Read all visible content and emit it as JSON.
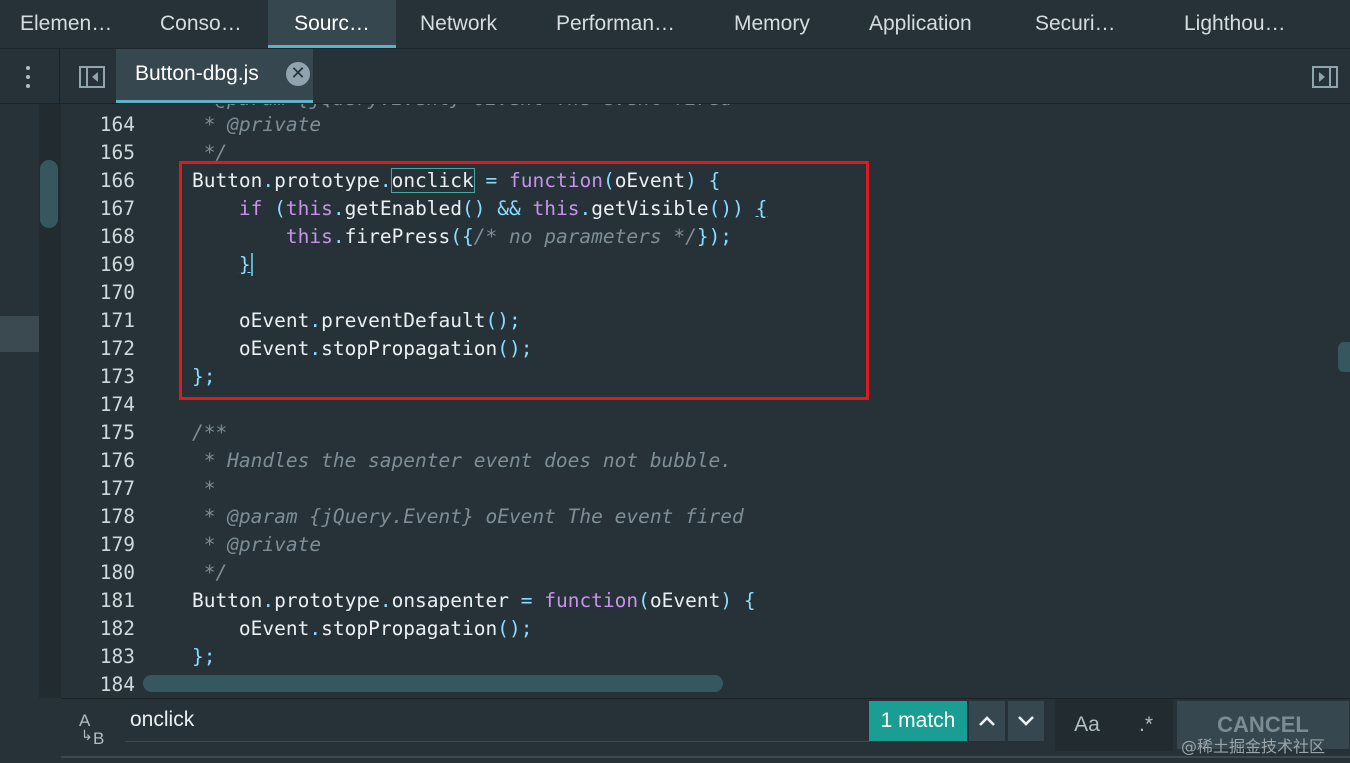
{
  "tabs": [
    {
      "label": "Elemen…"
    },
    {
      "label": "Conso…"
    },
    {
      "label": "Sourc…"
    },
    {
      "label": "Network"
    },
    {
      "label": "Performan…"
    },
    {
      "label": "Memory"
    },
    {
      "label": "Application"
    },
    {
      "label": "Securi…"
    },
    {
      "label": "Lighthou…"
    }
  ],
  "active_tab": "Sourc…",
  "file_tab": {
    "name": "Button-dbg.js",
    "close_glyph": "✕"
  },
  "line_numbers": [
    "164",
    "165",
    "166",
    "167",
    "168",
    "169",
    "170",
    "171",
    "172",
    "173",
    "174",
    "175",
    "176",
    "177",
    "178",
    "179",
    "180",
    "181",
    "182",
    "183",
    "184"
  ],
  "search": {
    "value": "onclick",
    "match_count": "1 match",
    "prev_glyph": "⌃",
    "next_glyph": "⌄",
    "case_label": "Aa",
    "regex_label": ".*",
    "cancel_label": "CANCEL",
    "ab_icon_top": "A",
    "ab_icon_bottom": "B"
  },
  "watermark": "@稀土掘金技术社区",
  "colors": {
    "background": "#263238",
    "accent": "#5bb3c4",
    "match_bg": "#1a9e93",
    "highlight_box": "#e01a1a",
    "keyword": "#c792ea",
    "punctuation": "#89ddff",
    "comment": "#7e8e96"
  }
}
